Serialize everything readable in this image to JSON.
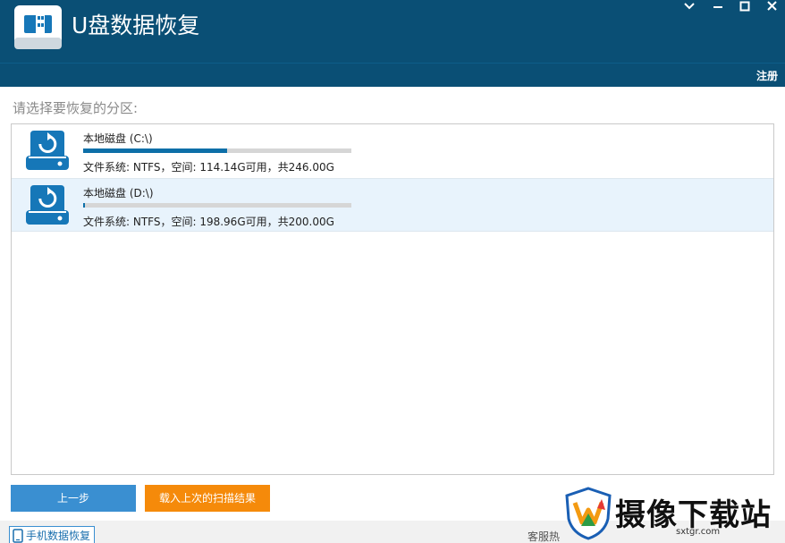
{
  "window": {
    "title": "U盘数据恢复",
    "controls": [
      "chevron-down-icon",
      "minimize-icon",
      "maximize-icon",
      "close-icon"
    ]
  },
  "header": {
    "register_label": "注册"
  },
  "main": {
    "section_label": "请选择要恢复的分区:",
    "partitions": [
      {
        "name": "本地磁盘 (C:\\)",
        "info": "文件系统: NTFS，空间: 114.14G可用，共246.00G",
        "used_fraction": 0.536,
        "selected": false
      },
      {
        "name": "本地磁盘 (D:\\)",
        "info": "文件系统: NTFS，空间: 198.96G可用，共200.00G",
        "used_fraction": 0.005,
        "selected": true
      }
    ]
  },
  "actions": {
    "back_label": "上一步",
    "load_label": "载入上次的扫描结果"
  },
  "footer": {
    "phone_recovery_label": "手机数据恢复",
    "hotline_label": "客服热"
  },
  "watermark": {
    "text": "摄像下载站",
    "url": "sxtgr.com"
  },
  "colors": {
    "titlebar": "#0a4f75",
    "usage_fill": "#0d6fa8",
    "back_button": "#3a8fd1",
    "load_button": "#f58a0a",
    "selected_row": "#e8f3fc"
  }
}
